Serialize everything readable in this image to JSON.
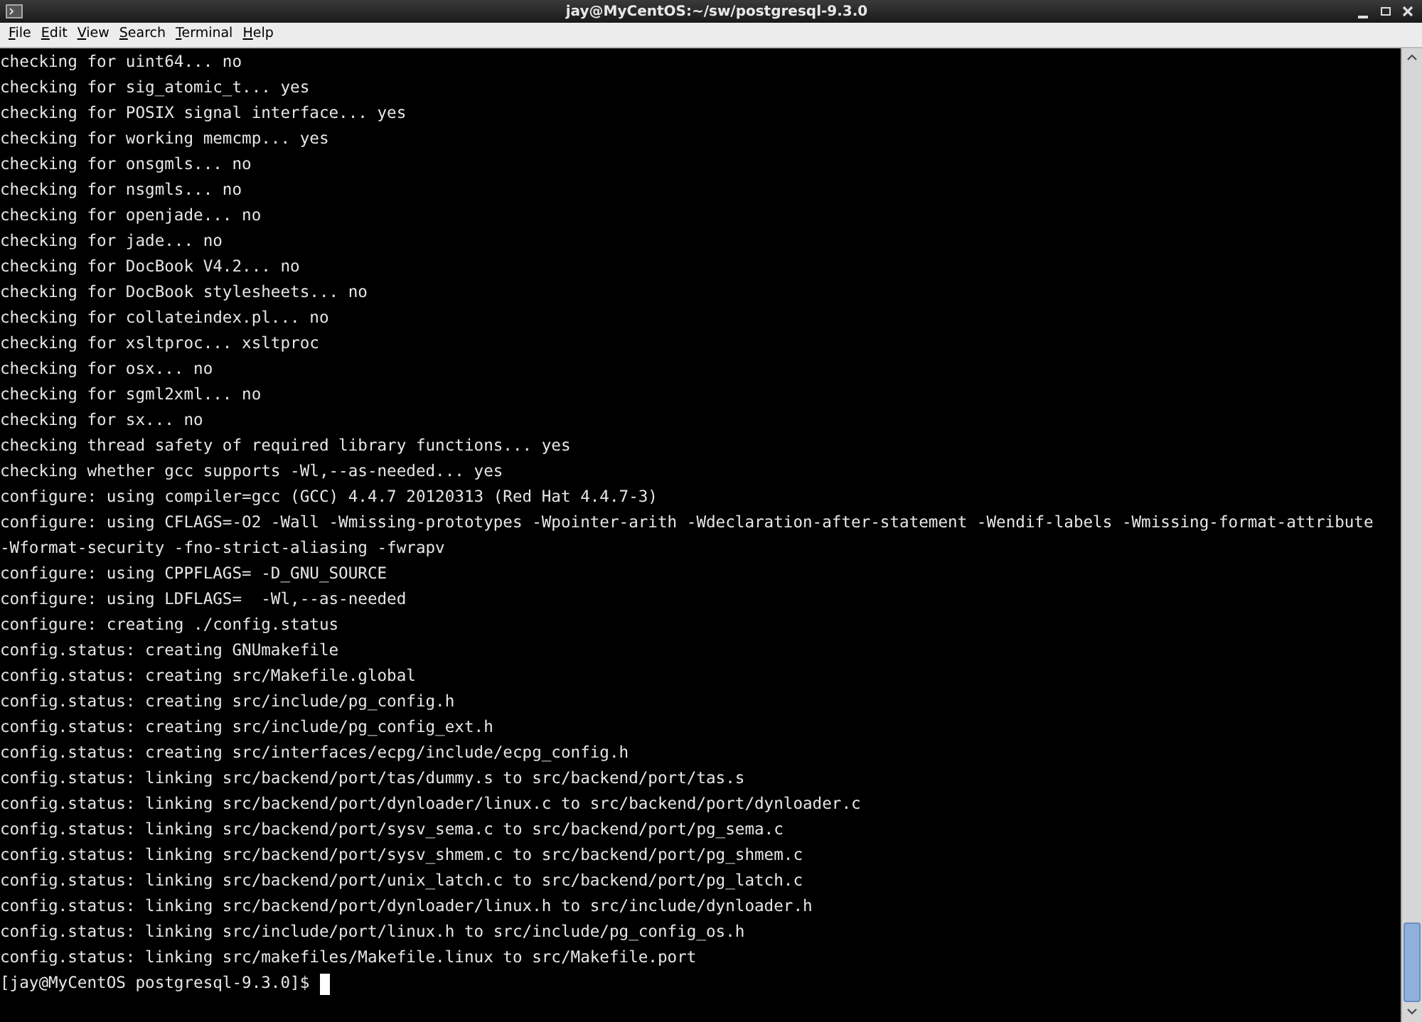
{
  "window": {
    "title": "jay@MyCentOS:~/sw/postgresql-9.3.0"
  },
  "menu": [
    {
      "label": "File"
    },
    {
      "label": "Edit"
    },
    {
      "label": "View"
    },
    {
      "label": "Search"
    },
    {
      "label": "Terminal"
    },
    {
      "label": "Help"
    }
  ],
  "terminal": {
    "lines": [
      "checking for uint64... no",
      "checking for sig_atomic_t... yes",
      "checking for POSIX signal interface... yes",
      "checking for working memcmp... yes",
      "checking for onsgmls... no",
      "checking for nsgmls... no",
      "checking for openjade... no",
      "checking for jade... no",
      "checking for DocBook V4.2... no",
      "checking for DocBook stylesheets... no",
      "checking for collateindex.pl... no",
      "checking for xsltproc... xsltproc",
      "checking for osx... no",
      "checking for sgml2xml... no",
      "checking for sx... no",
      "checking thread safety of required library functions... yes",
      "checking whether gcc supports -Wl,--as-needed... yes",
      "configure: using compiler=gcc (GCC) 4.4.7 20120313 (Red Hat 4.4.7-3)",
      "configure: using CFLAGS=-O2 -Wall -Wmissing-prototypes -Wpointer-arith -Wdeclaration-after-statement -Wendif-labels -Wmissing-format-attribute",
      "-Wformat-security -fno-strict-aliasing -fwrapv",
      "configure: using CPPFLAGS= -D_GNU_SOURCE",
      "configure: using LDFLAGS=  -Wl,--as-needed",
      "configure: creating ./config.status",
      "config.status: creating GNUmakefile",
      "config.status: creating src/Makefile.global",
      "config.status: creating src/include/pg_config.h",
      "config.status: creating src/include/pg_config_ext.h",
      "config.status: creating src/interfaces/ecpg/include/ecpg_config.h",
      "config.status: linking src/backend/port/tas/dummy.s to src/backend/port/tas.s",
      "config.status: linking src/backend/port/dynloader/linux.c to src/backend/port/dynloader.c",
      "config.status: linking src/backend/port/sysv_sema.c to src/backend/port/pg_sema.c",
      "config.status: linking src/backend/port/sysv_shmem.c to src/backend/port/pg_shmem.c",
      "config.status: linking src/backend/port/unix_latch.c to src/backend/port/pg_latch.c",
      "config.status: linking src/backend/port/dynloader/linux.h to src/include/dynloader.h",
      "config.status: linking src/include/port/linux.h to src/include/pg_config_os.h",
      "config.status: linking src/makefiles/Makefile.linux to src/Makefile.port"
    ],
    "prompt": "[jay@MyCentOS postgresql-9.3.0]$"
  }
}
